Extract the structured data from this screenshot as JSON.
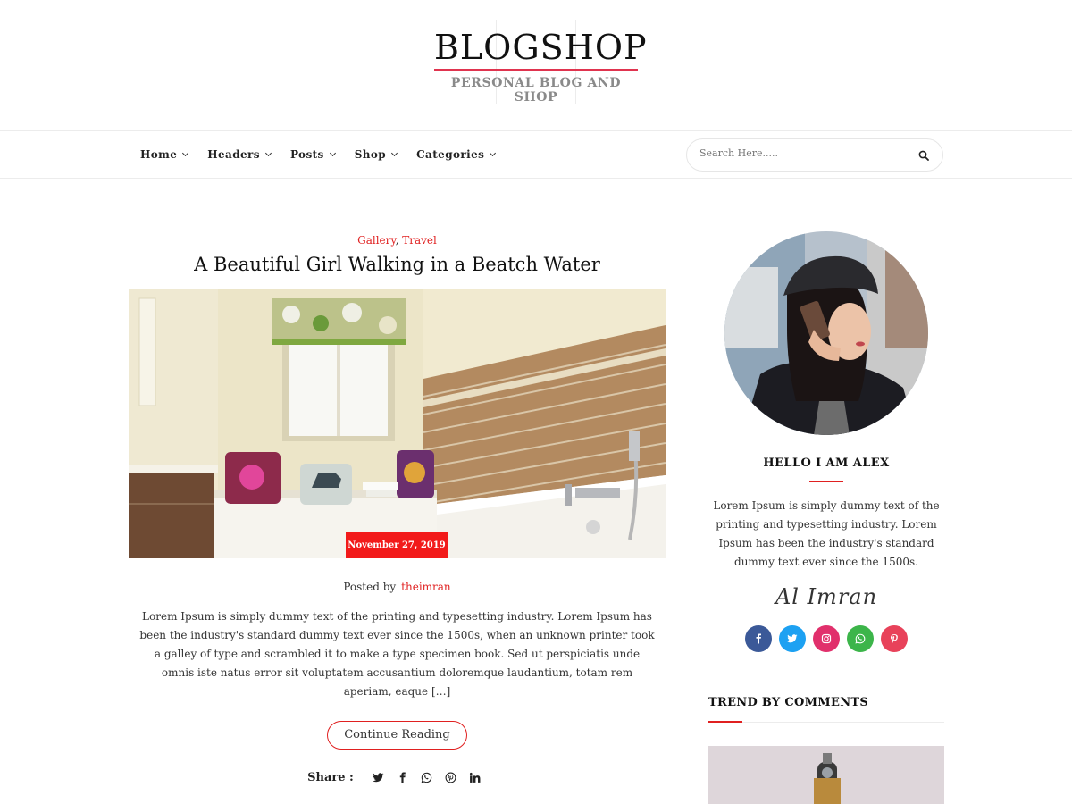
{
  "site": {
    "title": "BLOGSHOP",
    "tagline": "PERSONAL BLOG AND SHOP"
  },
  "nav": {
    "items": [
      {
        "label": "Home"
      },
      {
        "label": "Headers"
      },
      {
        "label": "Posts"
      },
      {
        "label": "Shop"
      },
      {
        "label": "Categories"
      }
    ],
    "search": {
      "placeholder": "Search Here....."
    }
  },
  "post": {
    "categories": [
      "Gallery",
      "Travel"
    ],
    "category_separator": ",",
    "title": "A Beautiful Girl Walking in a Beatch Water",
    "date": "November 27, 2019",
    "posted_by_label": "Posted by",
    "author": "theimran",
    "excerpt": "Lorem Ipsum is simply dummy text of the printing and typesetting industry. Lorem Ipsum has been the industry's standard dummy text ever since the 1500s, when an unknown printer took a galley of type and scrambled it to make a type specimen book. Sed ut perspiciatis unde omnis iste natus error sit voluptatem accusantium doloremque laudantium, totam rem aperiam, eaque […]",
    "continue_label": "Continue Reading",
    "share_label": "Share :",
    "share_icons": [
      "twitter-icon",
      "facebook-icon",
      "whatsapp-icon",
      "pinterest-icon",
      "linkedin-icon"
    ]
  },
  "sidebar": {
    "about_title": "HELLO I AM ALEX",
    "about_text": "Lorem Ipsum is simply dummy text of the printing and typesetting industry. Lorem Ipsum has been the industry's standard dummy text ever since the 1500s.",
    "signature": "Al Imran",
    "socials": [
      {
        "icon": "facebook-icon",
        "color": "#3b5998"
      },
      {
        "icon": "twitter-icon",
        "color": "#1da1f2"
      },
      {
        "icon": "instagram-icon",
        "color": "#e1306c"
      },
      {
        "icon": "whatsapp-icon",
        "color": "#3cb54a"
      },
      {
        "icon": "pinterest-icon",
        "color": "#e8425a"
      }
    ],
    "trend_title": "TREND BY COMMENTS"
  },
  "colors": {
    "accent": "#e02020",
    "brand_line": "#e0344f",
    "date_badge": "#f21a1a"
  }
}
